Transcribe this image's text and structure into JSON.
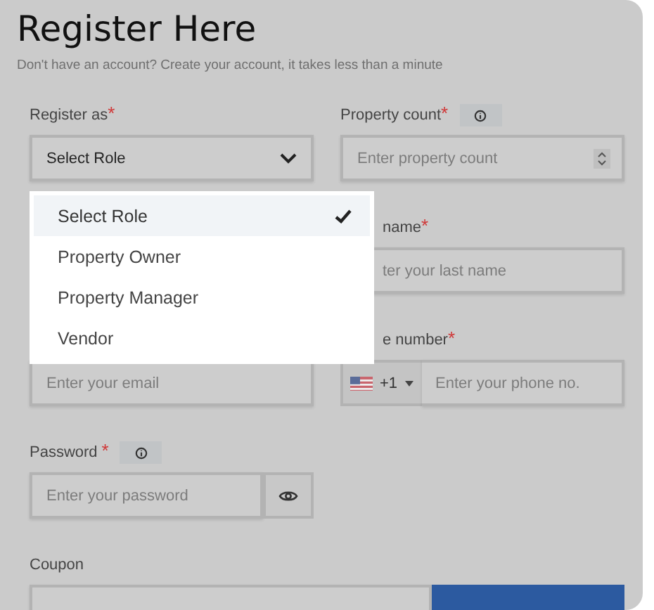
{
  "title": "Register Here",
  "subtitle": "Don't have an account? Create your account, it takes less than a minute",
  "register_as": {
    "label": "Register as",
    "required_mark": "*",
    "value": "Select Role"
  },
  "property_count": {
    "label": "Property count",
    "required_mark": "*",
    "placeholder": "Enter property count"
  },
  "last_name": {
    "label": "name",
    "required_mark": "*",
    "placeholder": "ter your last name"
  },
  "email": {
    "placeholder": "Enter your email"
  },
  "phone": {
    "label": "e number",
    "required_mark": "*",
    "country_code": "+1",
    "placeholder": "Enter your phone no."
  },
  "password": {
    "label": "Password",
    "required_mark": "*",
    "placeholder": "Enter your password"
  },
  "coupon": {
    "label": "Coupon"
  },
  "role_menu": {
    "options": [
      {
        "label": "Select Role",
        "selected": true
      },
      {
        "label": "Property Owner",
        "selected": false
      },
      {
        "label": "Property Manager",
        "selected": false
      },
      {
        "label": "Vendor",
        "selected": false
      }
    ]
  }
}
